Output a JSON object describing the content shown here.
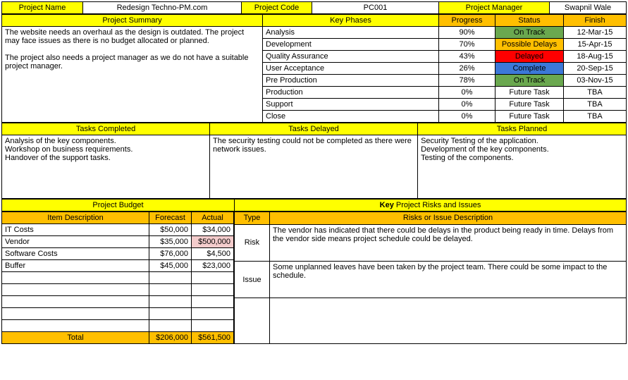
{
  "header": {
    "projectNameLabel": "Project Name",
    "projectName": "Redesign Techno-PM.com",
    "projectCodeLabel": "Project Code",
    "projectCode": "PC001",
    "projectManagerLabel": "Project Manager",
    "projectManager": "Swapnil Wale"
  },
  "summaryHeader": "Project Summary",
  "keyPhasesHeader": "Key Phases",
  "progressHeader": "Progress",
  "statusHeader": "Status",
  "finishHeader": "Finish",
  "summaryText": "The website needs an overhaul as the design is outdated. The project may face issues as there is no budget allocated or planned.\n\nThe project also needs a project manager as we do not have a suitable project manager.",
  "phases": [
    {
      "name": "Analysis",
      "progress": "90%",
      "status": "On Track",
      "finish": "12-Mar-15",
      "css": "status-ontrack"
    },
    {
      "name": "Development",
      "progress": "70%",
      "status": "Possible Delays",
      "finish": "15-Apr-15",
      "css": "status-possible"
    },
    {
      "name": "Quality Assurance",
      "progress": "43%",
      "status": "Delayed",
      "finish": "18-Aug-15",
      "css": "status-delayed"
    },
    {
      "name": "User Acceptance",
      "progress": "26%",
      "status": "Complete",
      "finish": "20-Sep-15",
      "css": "status-complete"
    },
    {
      "name": "Pre Production",
      "progress": "78%",
      "status": "On Track",
      "finish": "03-Nov-15",
      "css": "status-ontrack"
    },
    {
      "name": "Production",
      "progress": "0%",
      "status": "Future Task",
      "finish": "TBA",
      "css": "status-future"
    },
    {
      "name": "Support",
      "progress": "0%",
      "status": "Future Task",
      "finish": "TBA",
      "css": "status-future"
    },
    {
      "name": "Close",
      "progress": "0%",
      "status": "Future Task",
      "finish": "TBA",
      "css": "status-future"
    }
  ],
  "tasksCompletedHeader": "Tasks Completed",
  "tasksDelayedHeader": "Tasks Delayed",
  "tasksPlannedHeader": "Tasks Planned",
  "tasksCompleted": "Analysis of the key components.\nWorkshop on business requirements.\nHandover of the support tasks.",
  "tasksDelayed": "The security testing could not be completed as there were network issues.",
  "tasksPlanned": "Security Testing of the application.\nDevelopment of the key components.\nTesting of the components.",
  "budgetHeader": "Project Budget",
  "risksHeaderPrefix": "Key",
  "risksHeaderRest": " Project Risks and Issues",
  "itemDescHeader": "Item Description",
  "forecastHeader": "Forecast",
  "actualHeader": "Actual",
  "typeHeader": "Type",
  "riskDescHeader": "Risks or Issue Description",
  "budget": [
    {
      "item": "IT Costs",
      "forecast": "$50,000",
      "actual": "$34,000",
      "actualCss": ""
    },
    {
      "item": "Vendor",
      "forecast": "$35,000",
      "actual": "$500,000",
      "actualCss": "highlight-pink"
    },
    {
      "item": "Software Costs",
      "forecast": "$76,000",
      "actual": "$4,500",
      "actualCss": ""
    },
    {
      "item": "Buffer",
      "forecast": "$45,000",
      "actual": "$23,000",
      "actualCss": ""
    }
  ],
  "totalLabel": "Total",
  "totalForecast": "$206,000",
  "totalActual": "$561,500",
  "risks": [
    {
      "type": "Risk",
      "desc": "The vendor has indicated that there could be delays in the product being ready in time. Delays from the vendor side means project schedule could be delayed."
    },
    {
      "type": "Issue",
      "desc": "Some unplanned leaves have been taken by the project team. There could be some impact to the schedule."
    }
  ]
}
